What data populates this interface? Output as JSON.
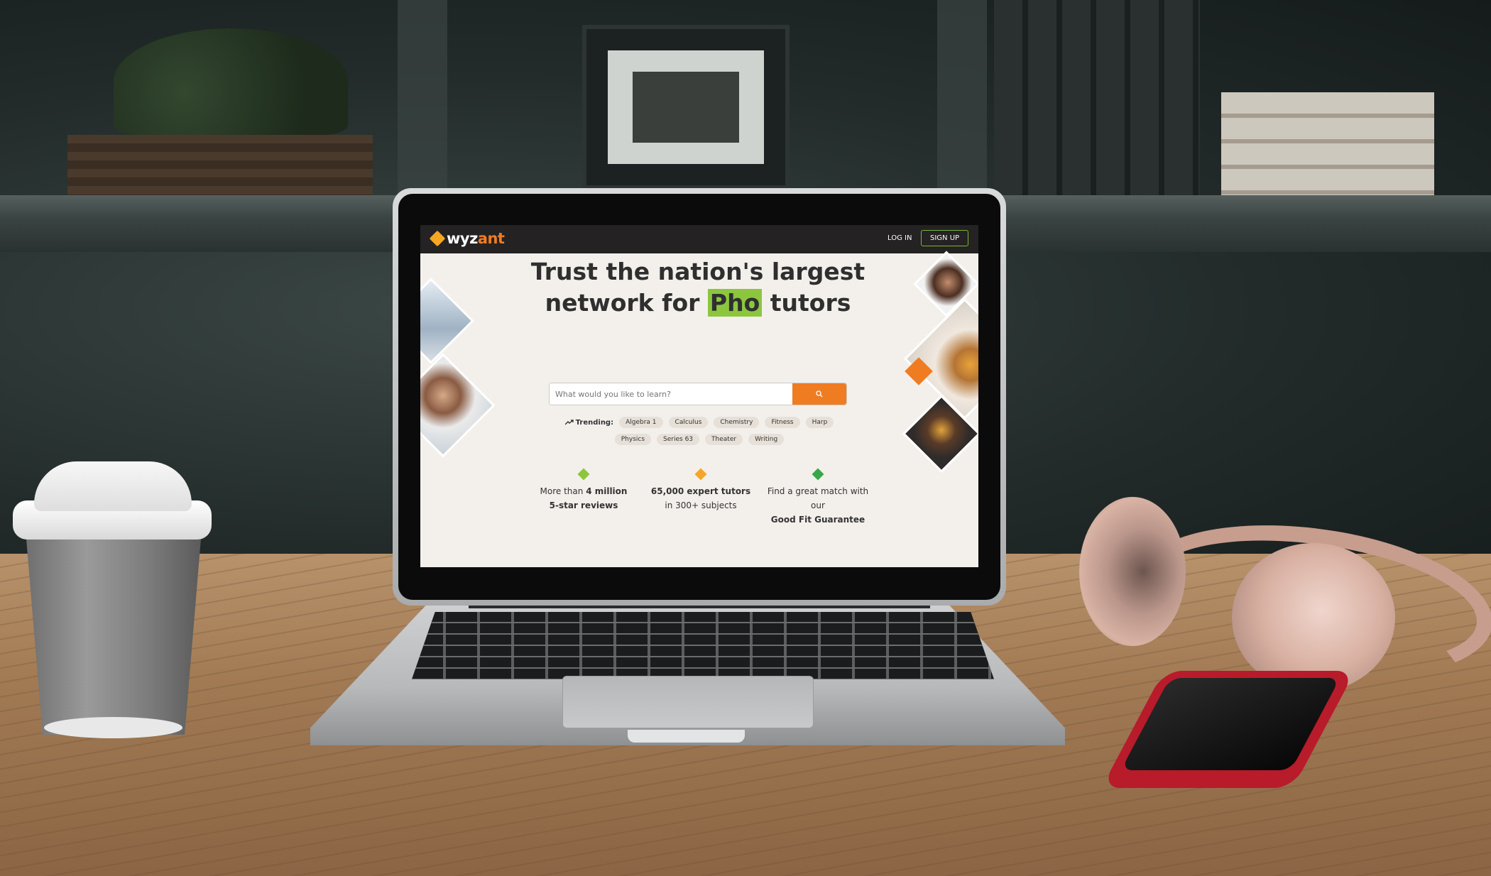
{
  "brand": {
    "name_part1": "wyz",
    "name_part2": "ant",
    "accent": "#f07c22",
    "green": "#8cc63f"
  },
  "nav": {
    "login": "LOG IN",
    "signup": "SIGN UP"
  },
  "hero": {
    "line1": "Trust the nation's largest",
    "line2_prefix": "network for ",
    "highlight": "Pho",
    "line2_suffix": " tutors"
  },
  "search": {
    "placeholder": "What would you like to learn?",
    "icon": "search-icon"
  },
  "trending": {
    "label": "Trending:",
    "row1": [
      "Algebra 1",
      "Calculus",
      "Chemistry",
      "Fitness",
      "Harp"
    ],
    "row2": [
      "Physics",
      "Series 63",
      "Theater",
      "Writing"
    ]
  },
  "stats": [
    {
      "line1_pre": "More than ",
      "line1_bold": "4 million",
      "line2_bold": "5-star reviews",
      "color": "#8cc63f"
    },
    {
      "line1_bold": "65,000 expert tutors",
      "line2": "in 300+ subjects",
      "color": "#f5a623"
    },
    {
      "line1": "Find a great match with our",
      "line2_bold": "Good Fit Guarantee",
      "color": "#3aa64b"
    }
  ]
}
